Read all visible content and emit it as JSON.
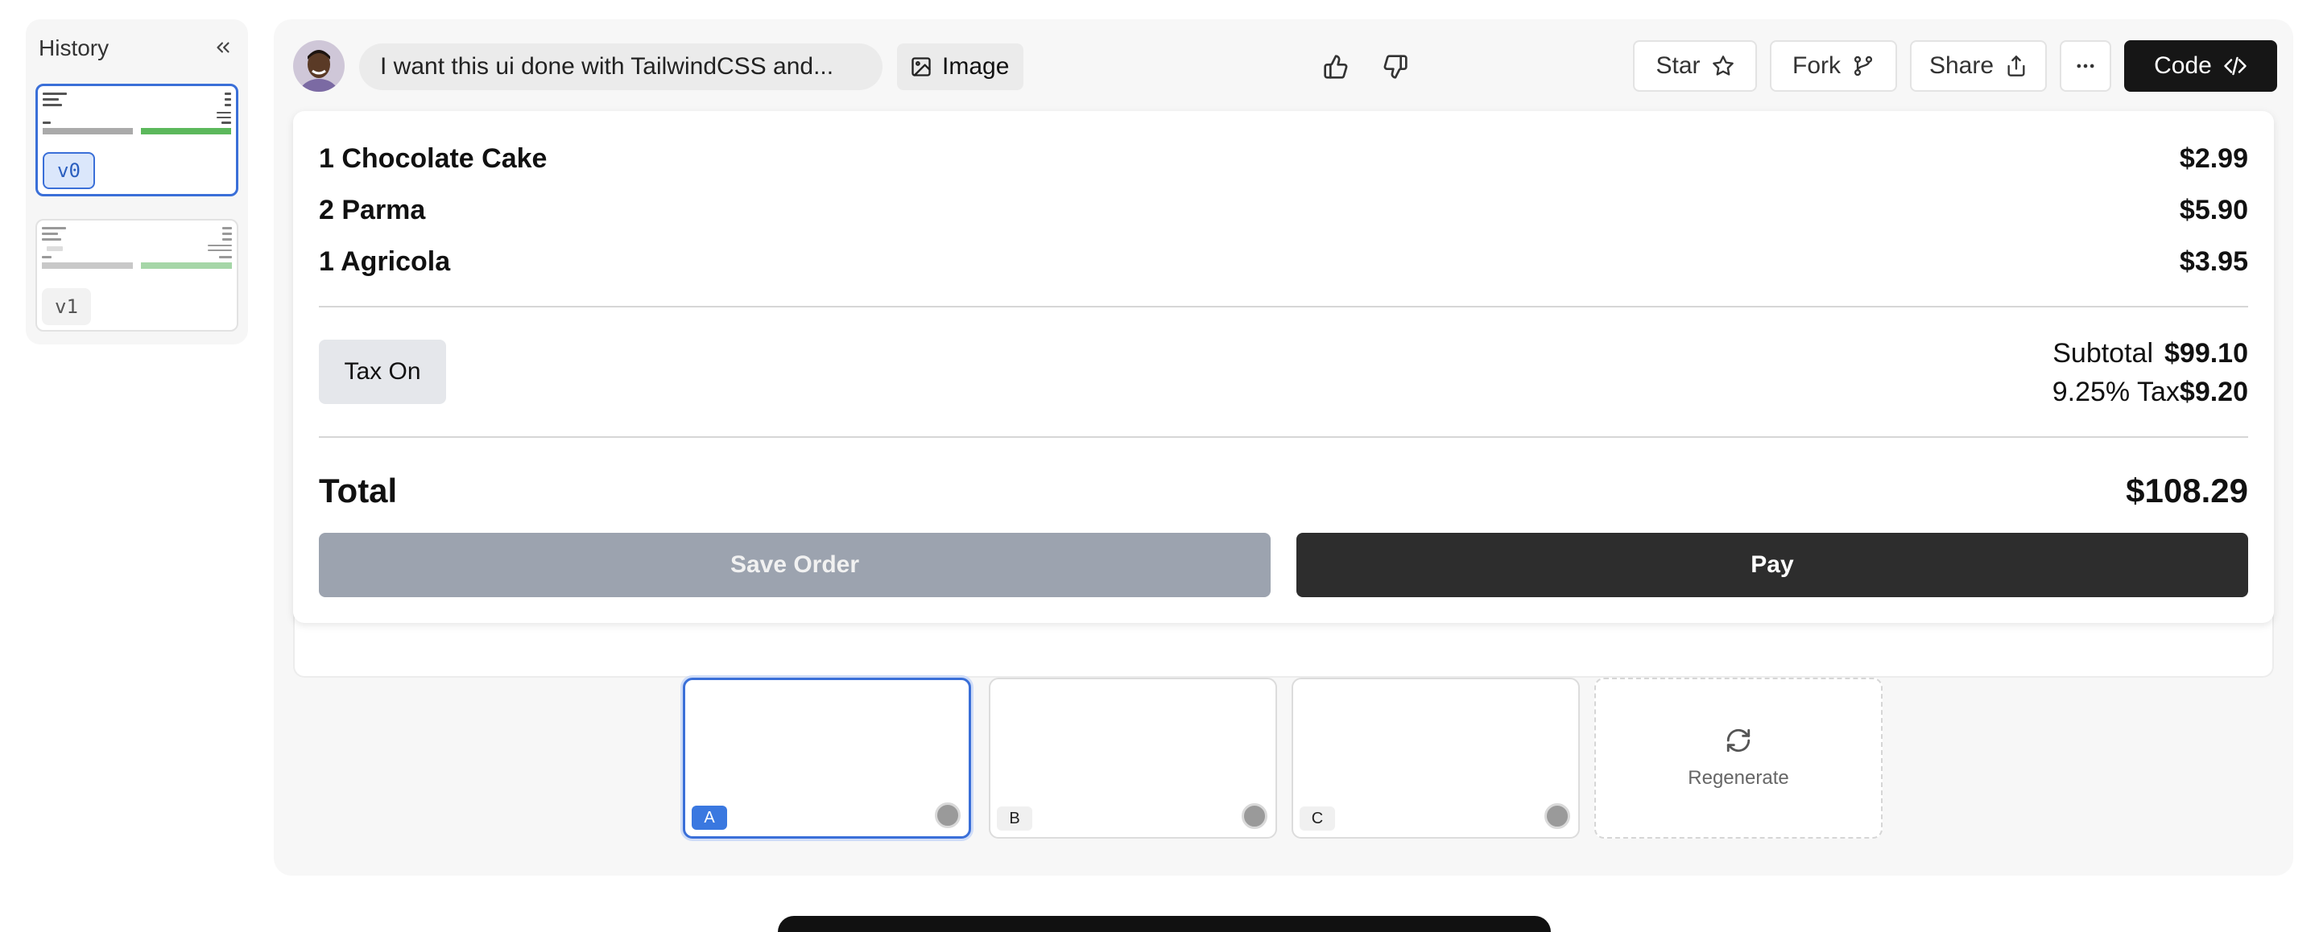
{
  "sidebar": {
    "title": "History",
    "versions": [
      {
        "label": "v0",
        "active": true
      },
      {
        "label": "v1",
        "active": false
      }
    ]
  },
  "topbar": {
    "prompt": "I want this ui done with TailwindCSS and...",
    "image_label": "Image",
    "star_label": "Star",
    "fork_label": "Fork",
    "share_label": "Share",
    "code_label": "Code"
  },
  "order": {
    "items": [
      {
        "name": "1 Chocolate Cake",
        "price": "$2.99"
      },
      {
        "name": "2 Parma",
        "price": "$5.90"
      },
      {
        "name": "1 Agricola",
        "price": "$3.95"
      }
    ],
    "tax_button": "Tax On",
    "subtotal_label": "Subtotal",
    "subtotal_value": "$99.10",
    "tax_label": "9.25% Tax",
    "tax_value": "$9.20",
    "total_label": "Total",
    "total_value": "$108.29",
    "save_label": "Save Order",
    "pay_label": "Pay"
  },
  "variants": {
    "items": [
      {
        "label": "A",
        "active": true
      },
      {
        "label": "B",
        "active": false
      },
      {
        "label": "C",
        "active": false
      }
    ],
    "regenerate_label": "Regenerate"
  },
  "colors": {
    "accent": "#3a6fd8",
    "dark_button": "#161616",
    "pay_button": "#2d2d2d",
    "save_button": "#9ca3af"
  }
}
